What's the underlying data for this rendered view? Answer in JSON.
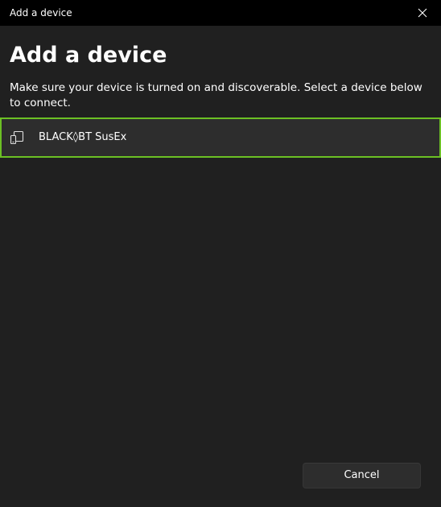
{
  "window": {
    "title": "Add a device"
  },
  "main": {
    "heading": "Add a device",
    "description": "Make sure your device is turned on and discoverable. Select a device below to connect."
  },
  "devices": [
    {
      "name": "BLACK◊BT SusEx",
      "icon": "phone-screen-device-icon"
    }
  ],
  "footer": {
    "cancel_label": "Cancel"
  },
  "colors": {
    "background": "#202020",
    "titlebar": "#000000",
    "selection_border": "#6cc024",
    "item_background": "#2d2d2d"
  }
}
